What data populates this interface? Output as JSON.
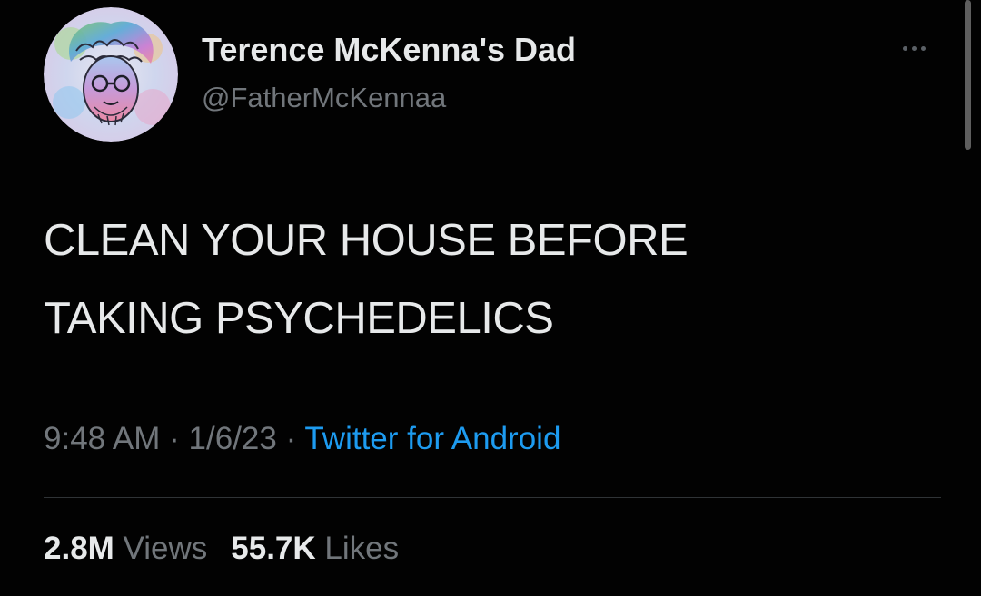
{
  "author": {
    "display_name": "Terence McKenna's Dad",
    "handle": "@FatherMcKennaa",
    "avatar_icon": "psychedelic-portrait-avatar"
  },
  "tweet": {
    "lines": [
      "CLEAN YOUR HOUSE BEFORE",
      "TAKING PSYCHEDELICS"
    ]
  },
  "meta": {
    "time": "9:48 AM",
    "separator": "·",
    "date": "1/6/23",
    "source": "Twitter for Android"
  },
  "stats": {
    "views_count": "2.8M",
    "views_label": "Views",
    "likes_count": "55.7K",
    "likes_label": "Likes"
  },
  "colors": {
    "background": "#020202",
    "text_primary": "#e7e9ea",
    "text_secondary": "#71767b",
    "link": "#1d9bf0",
    "divider": "#2f3336"
  },
  "icons": {
    "more": "more-horizontal-icon"
  }
}
